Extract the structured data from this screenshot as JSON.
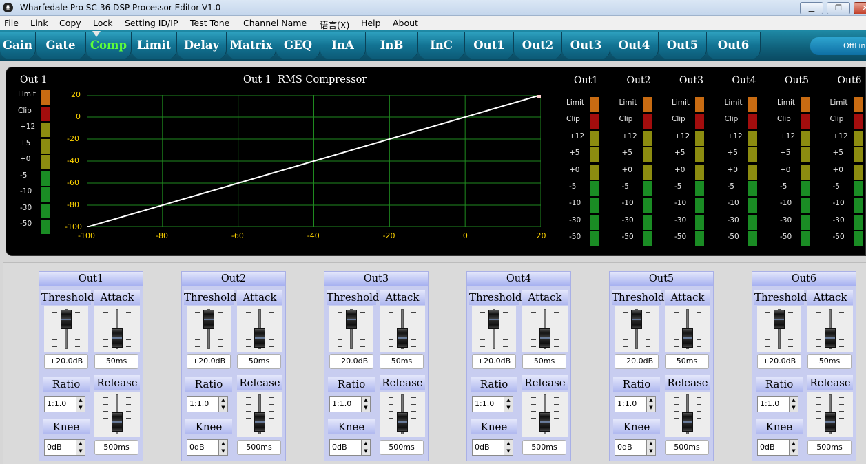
{
  "window": {
    "title": "Wharfedale Pro SC-36 DSP Processor Editor V1.0"
  },
  "menu": [
    "File",
    "Link",
    "Copy",
    "Lock",
    "Setting ID/IP",
    "Test Tone",
    "Channel Name",
    "语言(X)",
    "Help",
    "About"
  ],
  "tabs": [
    "Gain",
    "Gate",
    "Comp",
    "Limit",
    "Delay",
    "Matrix",
    "GEQ",
    "InA",
    "InB",
    "InC",
    "Out1",
    "Out2",
    "Out3",
    "Out4",
    "Out5",
    "Out6"
  ],
  "active_tab": "Comp",
  "status": {
    "offline": "OffLin"
  },
  "left_meter": {
    "title": "Out 1",
    "labels": [
      "Limit",
      "Clip",
      "+12",
      "+5",
      "+0",
      "-5",
      "-10",
      "-30",
      "-50"
    ]
  },
  "graph": {
    "title": "Out 1  RMS Compressor",
    "y_ticks": [
      "20",
      "0",
      "-20",
      "-40",
      "-60",
      "-80",
      "-100"
    ],
    "x_ticks": [
      "-100",
      "-80",
      "-60",
      "-40",
      "-20",
      "0",
      "20"
    ]
  },
  "chart_data": {
    "type": "line",
    "title": "Out 1  RMS Compressor",
    "xlim": [
      -100,
      20
    ],
    "ylim": [
      -100,
      20
    ],
    "series": [
      {
        "x": [
          -100,
          20
        ],
        "y": [
          -100,
          20
        ]
      }
    ],
    "grid": true
  },
  "right_meters": [
    {
      "title": "Out1"
    },
    {
      "title": "Out2"
    },
    {
      "title": "Out3"
    },
    {
      "title": "Out4"
    },
    {
      "title": "Out5"
    },
    {
      "title": "Out6"
    }
  ],
  "right_meter_labels": [
    "Limit",
    "Clip",
    "+12",
    "+5",
    "+0",
    "-5",
    "-10",
    "-30",
    "-50"
  ],
  "channel_labels": {
    "threshold": "Threshold",
    "attack": "Attack",
    "ratio": "Ratio",
    "release": "Release",
    "knee": "Knee"
  },
  "channels": [
    {
      "name": "Out1",
      "threshold": "+20.0dB",
      "attack": "50ms",
      "ratio": "1:1.0",
      "knee": "0dB",
      "release": "500ms"
    },
    {
      "name": "Out2",
      "threshold": "+20.0dB",
      "attack": "50ms",
      "ratio": "1:1.0",
      "knee": "0dB",
      "release": "500ms"
    },
    {
      "name": "Out3",
      "threshold": "+20.0dB",
      "attack": "50ms",
      "ratio": "1:1.0",
      "knee": "0dB",
      "release": "500ms"
    },
    {
      "name": "Out4",
      "threshold": "+20.0dB",
      "attack": "50ms",
      "ratio": "1:1.0",
      "knee": "0dB",
      "release": "500ms"
    },
    {
      "name": "Out5",
      "threshold": "+20.0dB",
      "attack": "50ms",
      "ratio": "1:1.0",
      "knee": "0dB",
      "release": "500ms"
    },
    {
      "name": "Out6",
      "threshold": "+20.0dB",
      "attack": "50ms",
      "ratio": "1:1.0",
      "knee": "0dB",
      "release": "500ms"
    }
  ],
  "colors": {
    "limit": "#c86b12",
    "clip": "#a30d0d",
    "level_high": "#8c8c10",
    "level_low": "#1a8c24",
    "grid": "#1f8a1f",
    "tick": "#ffd400",
    "line": "#ffffff"
  },
  "icons": {
    "app": "speaker-icon",
    "minimize": "minimize-icon",
    "maximize": "maximize-icon",
    "close": "close-icon"
  }
}
